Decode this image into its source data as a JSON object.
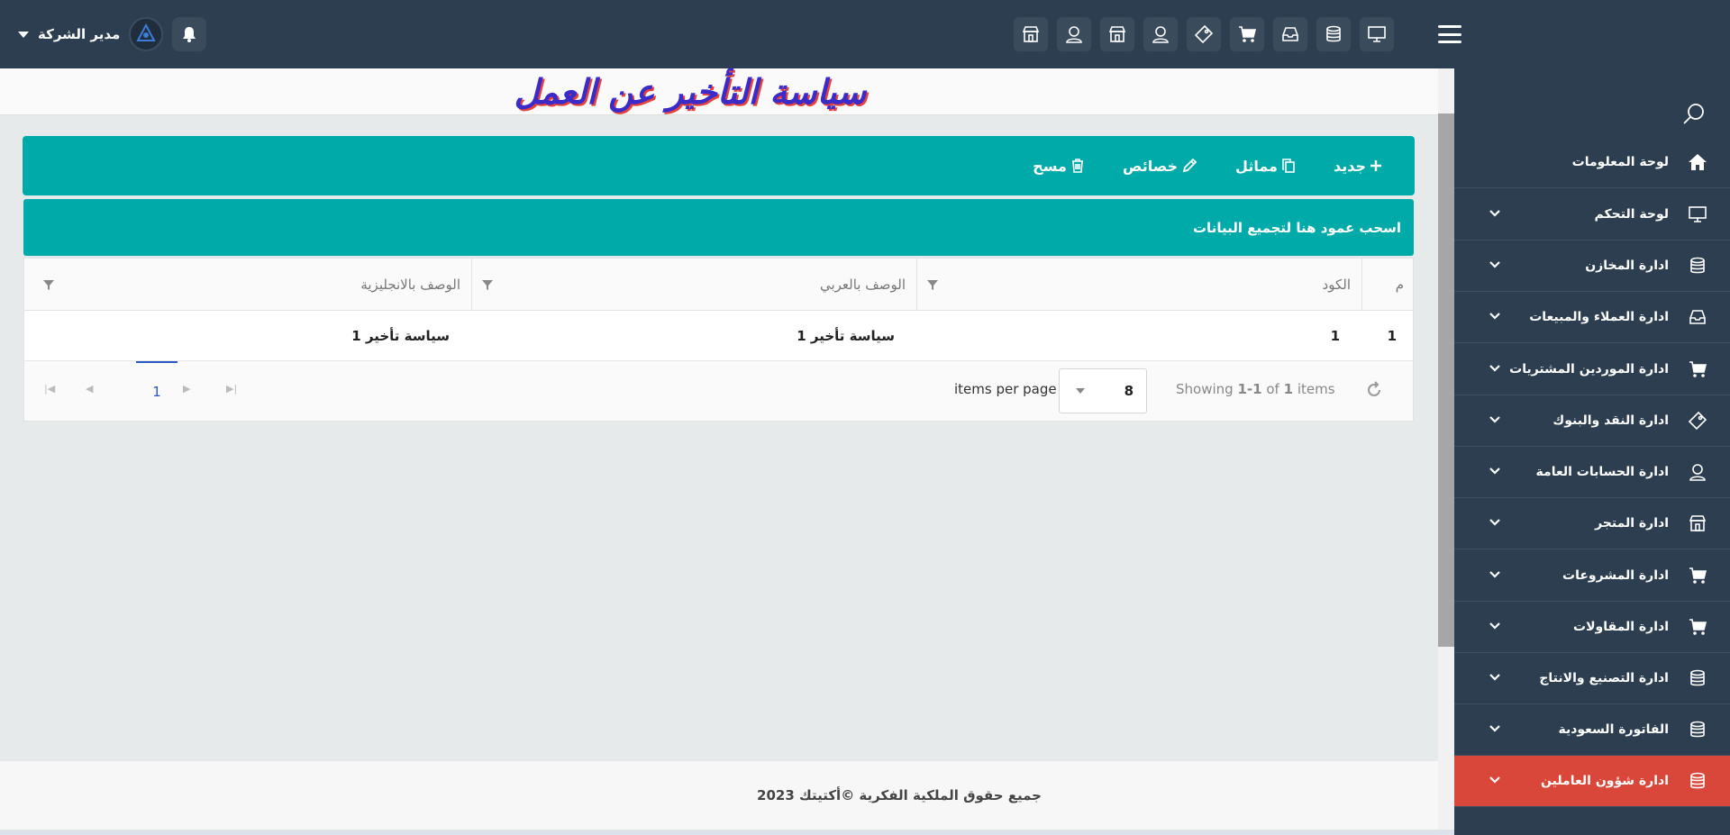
{
  "header": {
    "user_name": "مدير الشركة",
    "top_icons": [
      "monitor-icon",
      "database-icon",
      "inbox-icon",
      "cart-icon",
      "tag-icon",
      "user-icon",
      "store-icon",
      "user-icon",
      "store-icon"
    ]
  },
  "page": {
    "title": "سياسة التأخير عن العمل"
  },
  "toolbar": {
    "new_label": "جديد",
    "duplicate_label": "مماثل",
    "properties_label": "خصائص",
    "delete_label": "مسح"
  },
  "grid": {
    "group_hint": "اسحب عمود هنا لتجميع البيانات",
    "columns": {
      "index": "م",
      "code": "الكود",
      "desc_ar": "الوصف بالعربي",
      "desc_en": "الوصف بالانجليزية"
    },
    "rows": [
      {
        "index": "1",
        "code": "1",
        "desc_ar": "سياسة تأخير 1",
        "desc_en": "سياسة تأخير 1"
      }
    ],
    "pager": {
      "current_page": "1",
      "items_per_page": "8",
      "items_per_page_label": "items per page",
      "showing_prefix": "Showing",
      "showing_range": "1-1",
      "showing_of": "of",
      "showing_total": "1",
      "showing_suffix": "items"
    }
  },
  "footer": {
    "copyright": "جميع حقوق الملكية الفكرية ©أكتيتك 2023"
  },
  "sidebar": {
    "items": [
      {
        "label": "لوحة المعلومات",
        "icon": "home-icon"
      },
      {
        "label": "لوحة التحكم",
        "icon": "monitor-icon"
      },
      {
        "label": "ادارة المخازن",
        "icon": "database-icon"
      },
      {
        "label": "ادارة العملاء والمبيعات",
        "icon": "inbox-icon"
      },
      {
        "label": "ادارة الموردين المشتريات",
        "icon": "cart-icon"
      },
      {
        "label": "ادارة النقد والبنوك",
        "icon": "tag-icon"
      },
      {
        "label": "ادارة الحسابات العامة",
        "icon": "user-icon"
      },
      {
        "label": "ادارة المتجر",
        "icon": "store-icon"
      },
      {
        "label": "ادارة المشروعات",
        "icon": "cart-icon"
      },
      {
        "label": "ادارة المقاولات",
        "icon": "cart-icon"
      },
      {
        "label": "ادارة التصنيع والانتاج",
        "icon": "database-icon"
      },
      {
        "label": "الفاتورة السعودية",
        "icon": "database-icon"
      },
      {
        "label": "ادارة شؤون العاملين",
        "icon": "database-icon"
      }
    ],
    "active_color": "#d9473a"
  },
  "colors": {
    "topbar": "#2c3e50",
    "toolbar": "#00aaa8",
    "title": "#3b2bc9",
    "title_shadow": "#e8433a"
  }
}
